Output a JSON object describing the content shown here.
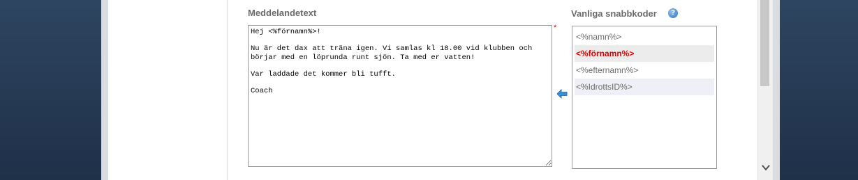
{
  "message": {
    "label": "Meddelandetext",
    "body": "Hej <%förnamn%>!\n\nNu är det dax att träna igen. Vi samlas kl 18.00 vid klubben och\nbörjar med en löprunda runt sjön. Ta med er vatten!\n\nVar laddade det kommer bli tufft.\n\nCoach",
    "required_mark": "*"
  },
  "shortcodes": {
    "label": "Vanliga snabbkoder",
    "help_glyph": "?",
    "items": [
      {
        "label": "<%namn%>",
        "selected": false
      },
      {
        "label": "<%förnamn%>",
        "selected": true
      },
      {
        "label": "<%efternamn%>",
        "selected": false
      },
      {
        "label": "<%IdrottsID%>",
        "selected": false
      }
    ]
  },
  "colors": {
    "selected_code": "#e00000",
    "arrow": "#3a8fd6",
    "background": "#2a3e55"
  },
  "icons": {
    "help": "help-icon",
    "insert": "arrow-left-icon",
    "scroll_down": "chevron-down-icon"
  }
}
